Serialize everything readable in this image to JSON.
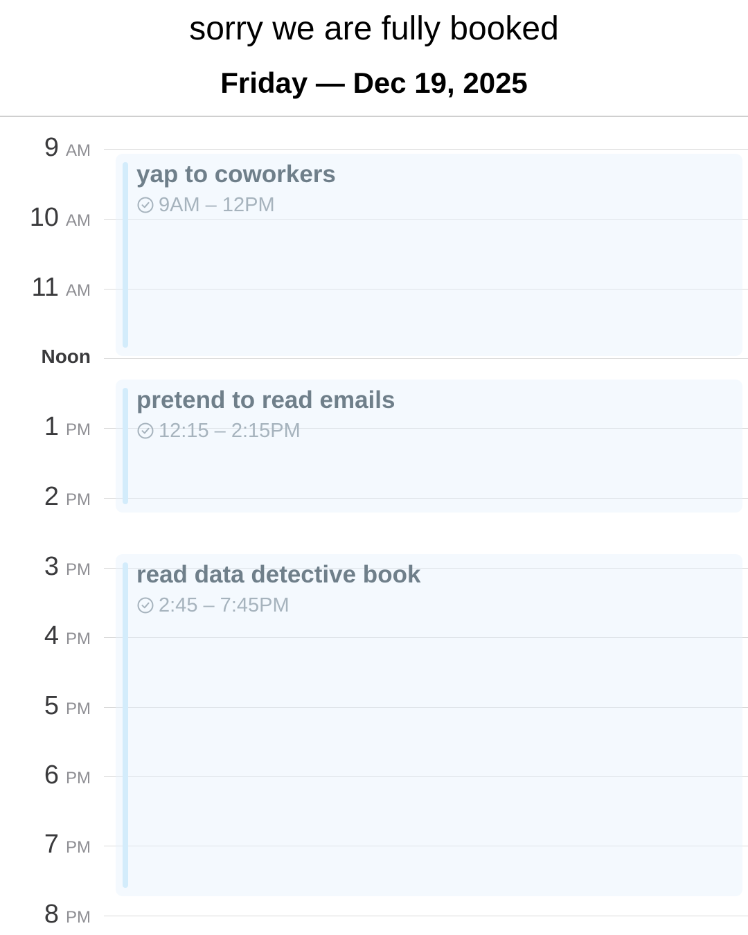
{
  "caption": "sorry we are fully booked",
  "date_header": "Friday — Dec 19, 2025",
  "hours": [
    {
      "num": "9",
      "suffix": "AM"
    },
    {
      "num": "10",
      "suffix": "AM"
    },
    {
      "num": "11",
      "suffix": "AM"
    },
    {
      "num": "Noon",
      "suffix": ""
    },
    {
      "num": "1",
      "suffix": "PM"
    },
    {
      "num": "2",
      "suffix": "PM"
    },
    {
      "num": "3",
      "suffix": "PM"
    },
    {
      "num": "4",
      "suffix": "PM"
    },
    {
      "num": "5",
      "suffix": "PM"
    },
    {
      "num": "6",
      "suffix": "PM"
    },
    {
      "num": "7",
      "suffix": "PM"
    },
    {
      "num": "8",
      "suffix": "PM"
    }
  ],
  "events": [
    {
      "title": "yap to coworkers",
      "time": "9AM – 12PM",
      "icon": "clock-icon"
    },
    {
      "title": "pretend to read emails",
      "time": "12:15 – 2:15PM",
      "icon": "clock-icon"
    },
    {
      "title": "read data detective book",
      "time": "2:45 – 7:45PM",
      "icon": "clock-icon"
    }
  ],
  "colors": {
    "event_fill": "#f4f9fd",
    "event_accent": "#d3ecfb",
    "event_title": "#6f7f8a",
    "event_time": "#a6b3bd"
  }
}
